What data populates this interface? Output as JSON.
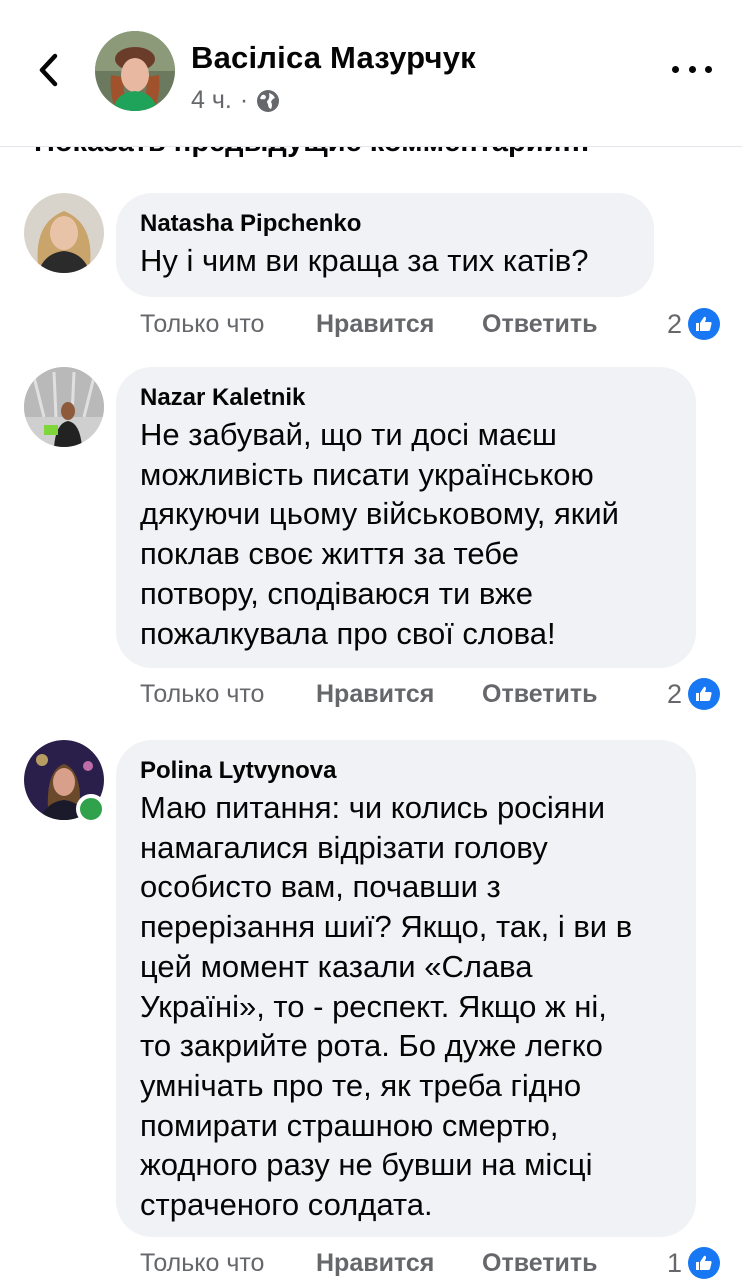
{
  "header": {
    "name": "Васіліса Мазурчук",
    "time": "4 ч.",
    "separator": "·",
    "privacy_icon": "globe-icon",
    "back_icon": "chevron-left-icon",
    "more_icon": "more-horizontal-icon"
  },
  "prev_comments_label": "Показать предыдущие комментарии…",
  "comments": [
    {
      "author": "Natasha Pipchenko",
      "text": "Ну і чим ви краща за тих катів?",
      "time": "Только что",
      "like_label": "Нравится",
      "reply_label": "Ответить",
      "reactions": "2",
      "online": false
    },
    {
      "author": "Nazar Kaletnik",
      "text": "Не забувай, що ти досі маєш\nможливість писати українською\nдякуючи цьому військовому, який\nпоклав своє життя за тебе\nпотвору, сподіваюся ти вже\nпожалкувала про свої слова!",
      "time": "Только что",
      "like_label": "Нравится",
      "reply_label": "Ответить",
      "reactions": "2",
      "online": false
    },
    {
      "author": "Polina Lytvynova",
      "text": "Маю питання: чи колись росіяни\nнамагалися відрізати голову\nособисто вам, почавши з\nперерізання шиї? Якщо, так, і ви в\nцей момент казали «Слава\nУкраїні», то - респект. Якщо ж ні,\nто закрийте рота. Бо дуже легко\nумнічать про те, як треба гідно\nпомирати страшною смертю,\nжодного разу не бувши на місці\nстраченого солдата.",
      "time": "Только что",
      "like_label": "Нравится",
      "reply_label": "Ответить",
      "reactions": "1",
      "online": true
    }
  ],
  "colors": {
    "bubble": "#f0f2f5",
    "meta_text": "#65676b",
    "like_blue": "#1877f2",
    "online_green": "#31a24c"
  }
}
